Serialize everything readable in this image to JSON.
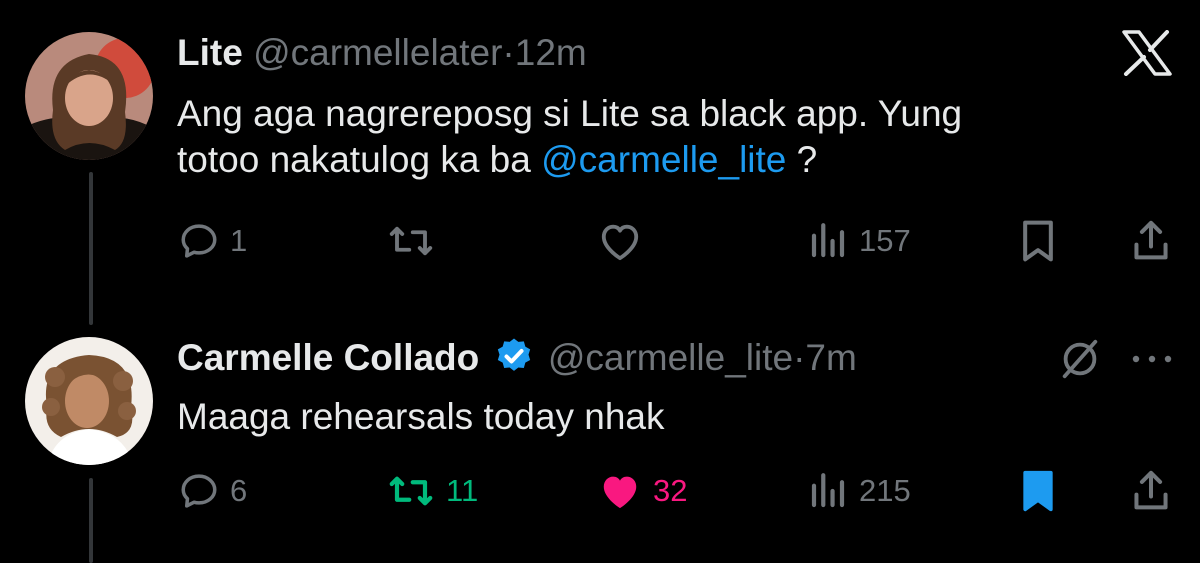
{
  "colors": {
    "background": "#000000",
    "text": "#e7e9ea",
    "muted": "#71767b",
    "link": "#1d9bf0",
    "retweet_active": "#00ba7c",
    "like_active": "#f91880",
    "bookmark_active": "#1d9bf0"
  },
  "tweets": [
    {
      "author_name": "Lite",
      "handle": "@carmellelater",
      "separator": "·",
      "time": "12m",
      "text_line1": "Ang aga nagrereposg si Lite sa black app. Yung",
      "text_line2_prefix": "totoo nakatulog ka ba ",
      "mention": "@carmelle_lite",
      "text_line2_suffix": " ?",
      "actions": {
        "replies": "1",
        "retweets": "",
        "likes": "",
        "views": "157"
      },
      "icons": [
        "reply-icon",
        "retweet-icon",
        "like-icon",
        "views-icon",
        "bookmark-icon",
        "share-icon"
      ]
    },
    {
      "author_name": "Carmelle Collado",
      "verified": true,
      "handle": "@carmelle_lite",
      "separator": "·",
      "time": "7m",
      "text": "Maaga rehearsals today nhak",
      "actions": {
        "replies": "6",
        "retweets": "11",
        "likes": "32",
        "views": "215"
      },
      "states": {
        "retweeted": true,
        "liked": true,
        "bookmarked": true
      },
      "icons": [
        "reply-icon",
        "retweet-icon",
        "heart-filled-icon",
        "views-icon",
        "bookmark-filled-icon",
        "share-icon"
      ]
    }
  ],
  "header_icons": {
    "top_right": "x-logo-icon",
    "reply_menu": [
      "grok-icon",
      "more-icon"
    ]
  }
}
